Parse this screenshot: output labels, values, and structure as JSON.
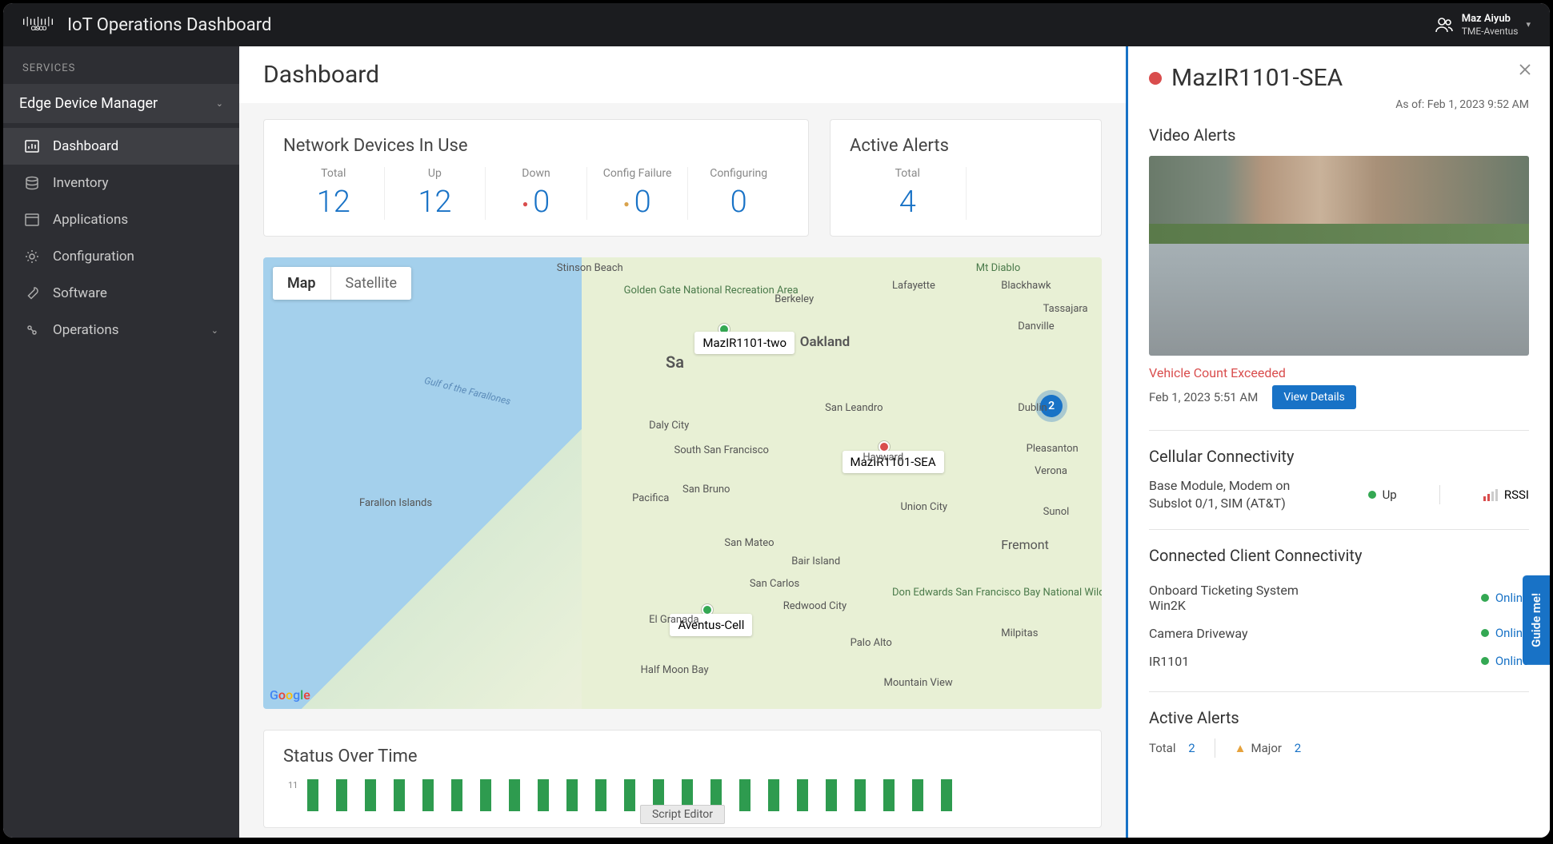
{
  "header": {
    "app_title": "IoT Operations Dashboard",
    "logo_text": "cisco",
    "user": {
      "name": "Maz Aiyub",
      "org": "TME-Aventus"
    }
  },
  "sidebar": {
    "services_label": "SERVICES",
    "service_selected": "Edge Device Manager",
    "items": [
      {
        "label": "Dashboard"
      },
      {
        "label": "Inventory"
      },
      {
        "label": "Applications"
      },
      {
        "label": "Configuration"
      },
      {
        "label": "Software"
      },
      {
        "label": "Operations"
      }
    ]
  },
  "page": {
    "title": "Dashboard"
  },
  "network_card": {
    "title": "Network Devices In Use",
    "stats": [
      {
        "label": "Total",
        "value": "12"
      },
      {
        "label": "Up",
        "value": "12"
      },
      {
        "label": "Down",
        "value": "0"
      },
      {
        "label": "Config Failure",
        "value": "0"
      },
      {
        "label": "Configuring",
        "value": "0"
      }
    ]
  },
  "alerts_card": {
    "title": "Active Alerts",
    "total_label": "Total",
    "total_value": "4"
  },
  "map": {
    "tab_map": "Map",
    "tab_sat": "Satellite",
    "gulf": "Gulf of the Farallones",
    "farallon": "Farallon Islands",
    "cluster": "2",
    "markers": {
      "m1": "MazIR1101-two",
      "m2": "MazIR1101-SEA",
      "m3": "Aventus-Cell"
    },
    "cities": {
      "oakland": "Oakland",
      "berkeley": "Berkeley",
      "sa": "Sa",
      "hayward": "Hayward",
      "fremont": "Fremont",
      "paloalto": "Palo Alto",
      "redwood": "Redwood City",
      "sanmateo": "San Mateo",
      "dalycity": "Daly City",
      "pacifica": "Pacifica",
      "ssf": "South San Francisco",
      "sanbruno": "San Bruno",
      "halfmoon": "Half Moon Bay",
      "elgranada": "El Granada",
      "sanleandro": "San Leandro",
      "unioncity": "Union City",
      "pleasanton": "Pleasanton",
      "dublin": "Dublin",
      "danville": "Danville",
      "blackhawk": "Blackhawk",
      "tassajara": "Tassajara",
      "lafayette": "Lafayette",
      "mtdiablo": "Mt Diablo",
      "sunol": "Sunol",
      "milpitas": "Milpitas",
      "mtview": "Mountain View",
      "sancarlos": "San Carlos",
      "bair": "Bair Island",
      "stinson": "Stinson Beach",
      "verona": "Verona",
      "ggnra": "Golden Gate National Recreation Area",
      "desfnwr": "Don Edwards San Francisco Bay National Wildlife"
    }
  },
  "sot": {
    "title": "Status Over Time",
    "ylabel": "11",
    "script_editor": "Script Editor"
  },
  "panel": {
    "title": "MazIR1101-SEA",
    "asof_prefix": "As of: ",
    "asof": "Feb 1, 2023 9:52 AM",
    "video_title": "Video Alerts",
    "alert_name": "Vehicle Count Exceeded",
    "alert_time": "Feb 1, 2023 5:51 AM",
    "view_details": "View Details",
    "cellular_title": "Cellular Connectivity",
    "cell_module": "Base Module, Modem on Subslot 0/1, SIM (AT&T)",
    "up": "Up",
    "rssi": "RSSI",
    "clients_title": "Connected Client Connectivity",
    "clients": [
      {
        "name": "Onboard Ticketing System Win2K",
        "status": "Online"
      },
      {
        "name": "Camera Driveway",
        "status": "Online"
      },
      {
        "name": "IR1101",
        "status": "Online"
      }
    ],
    "active_alerts_title": "Active Alerts",
    "alerts_total_label": "Total",
    "alerts_total_value": "2",
    "alerts_major_label": "Major",
    "alerts_major_value": "2"
  },
  "guide": {
    "label": "Guide me!"
  }
}
